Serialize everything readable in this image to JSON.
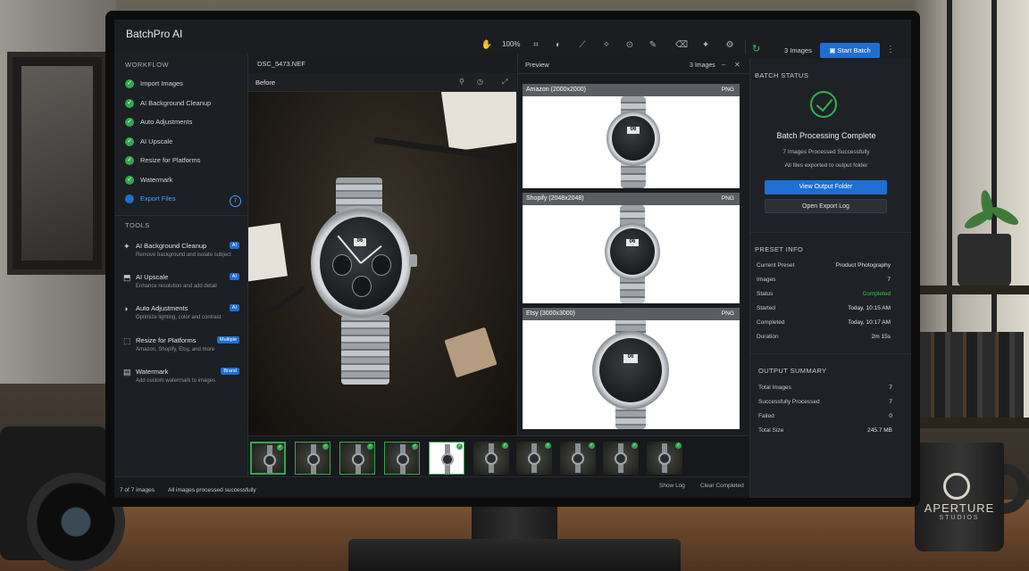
{
  "app": {
    "brand": "BatchPro AI",
    "zoom": "100%"
  },
  "toolbar": {
    "image_count": "3 Images",
    "start_batch": "Start Batch"
  },
  "workflow": {
    "title": "WORKFLOW",
    "steps": [
      {
        "label": "Import Images",
        "state": "done"
      },
      {
        "label": "AI Background Cleanup",
        "state": "done"
      },
      {
        "label": "Auto Adjustments",
        "state": "done"
      },
      {
        "label": "AI Upscale",
        "state": "done"
      },
      {
        "label": "Resize for Platforms",
        "state": "done"
      },
      {
        "label": "Watermark",
        "state": "done"
      },
      {
        "label": "Export Files",
        "state": "active"
      }
    ],
    "export_count": "7"
  },
  "tools": {
    "title": "TOOLS",
    "items": [
      {
        "name": "AI Background Cleanup",
        "desc": "Remove background and isolate subject",
        "tag": "AI"
      },
      {
        "name": "AI Upscale",
        "desc": "Enhance resolution and add detail",
        "tag": "AI"
      },
      {
        "name": "Auto Adjustments",
        "desc": "Optimize lighting, color and contrast",
        "tag": "AI"
      },
      {
        "name": "Resize for Platforms",
        "desc": "Amazon, Shopify, Etsy, and more",
        "tag": "Multiple"
      },
      {
        "name": "Watermark",
        "desc": "Add custom watermark to images",
        "tag": "Brand"
      }
    ]
  },
  "editor": {
    "file_name": "DSC_5473.NEF",
    "view_label": "Before"
  },
  "preview": {
    "title": "Preview",
    "count": "3 Images",
    "cards": [
      {
        "title": "Amazon (2000x2000)",
        "format": "PNG"
      },
      {
        "title": "Shopify (2048x2048)",
        "format": "PNG"
      },
      {
        "title": "Etsy (3000x3000)",
        "format": "PNG"
      }
    ]
  },
  "batch_status": {
    "title": "BATCH STATUS",
    "headline": "Batch Processing Complete",
    "line1": "7 Images Processed Successfully",
    "line2": "All files exported to output folder",
    "view_button": "View Output Folder",
    "log_button": "Open Export Log"
  },
  "preset_info": {
    "title": "PRESET INFO",
    "rows": [
      {
        "k": "Current Preset",
        "v": "Product Photography"
      },
      {
        "k": "Images",
        "v": "7"
      },
      {
        "k": "Status",
        "v": "Completed"
      },
      {
        "k": "Started",
        "v": "Today, 10:15 AM"
      },
      {
        "k": "Completed",
        "v": "Today, 10:17 AM"
      },
      {
        "k": "Duration",
        "v": "2m 15s"
      }
    ]
  },
  "output_summary": {
    "title": "OUTPUT SUMMARY",
    "rows": [
      {
        "k": "Total Images",
        "v": "7"
      },
      {
        "k": "Successfully Processed",
        "v": "7"
      },
      {
        "k": "Failed",
        "v": "0"
      },
      {
        "k": "Total Size",
        "v": "245.7 MB"
      }
    ]
  },
  "statusbar": {
    "count": "7 of 7 images",
    "message": "All images processed successfully",
    "show_log": "Show Log",
    "clear_completed": "Clear Completed"
  },
  "mug": {
    "brand": "APERTURE",
    "sub": "STUDIOS"
  },
  "colors": {
    "accent": "#1f6fd1",
    "success": "#2fa84f",
    "panel": "#1e2125"
  }
}
